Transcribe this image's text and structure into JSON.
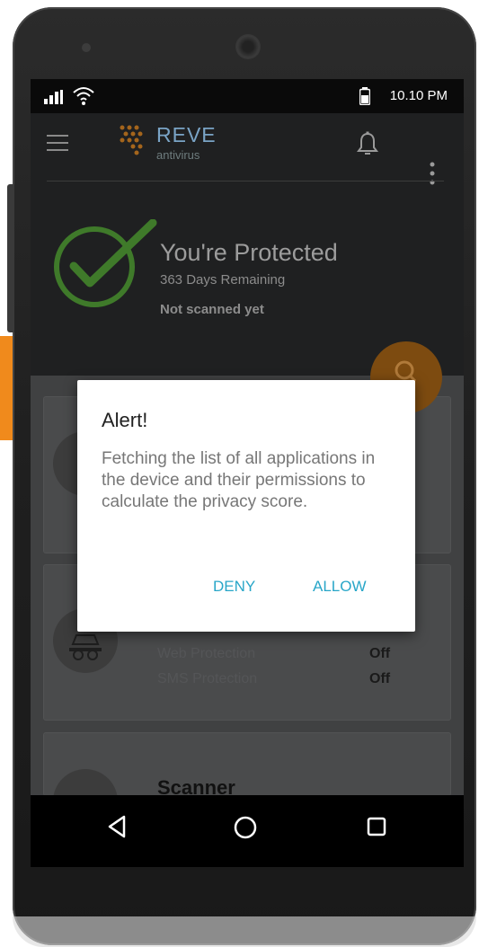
{
  "status_bar": {
    "time": "10.10 PM"
  },
  "app_bar": {
    "brand": "REVE",
    "brand_sub": "antivirus"
  },
  "protection": {
    "title": "You're Protected",
    "days_remaining": "363 Days Remaining",
    "scan_status": "Not scanned yet"
  },
  "cards": {
    "protection_rows": [
      {
        "label": "Web Protection",
        "value": "Off"
      },
      {
        "label": "SMS Protection",
        "value": "Off"
      }
    ],
    "scanner_title": "Scanner"
  },
  "dialog": {
    "title": "Alert!",
    "message": "Fetching the list of all applications in the device and their permissions to calculate the privacy score.",
    "deny_label": "DENY",
    "allow_label": "ALLOW"
  },
  "colors": {
    "accent": "#28a6c8",
    "check_green": "#3f7a2a",
    "fab_orange": "#f08a1c"
  }
}
